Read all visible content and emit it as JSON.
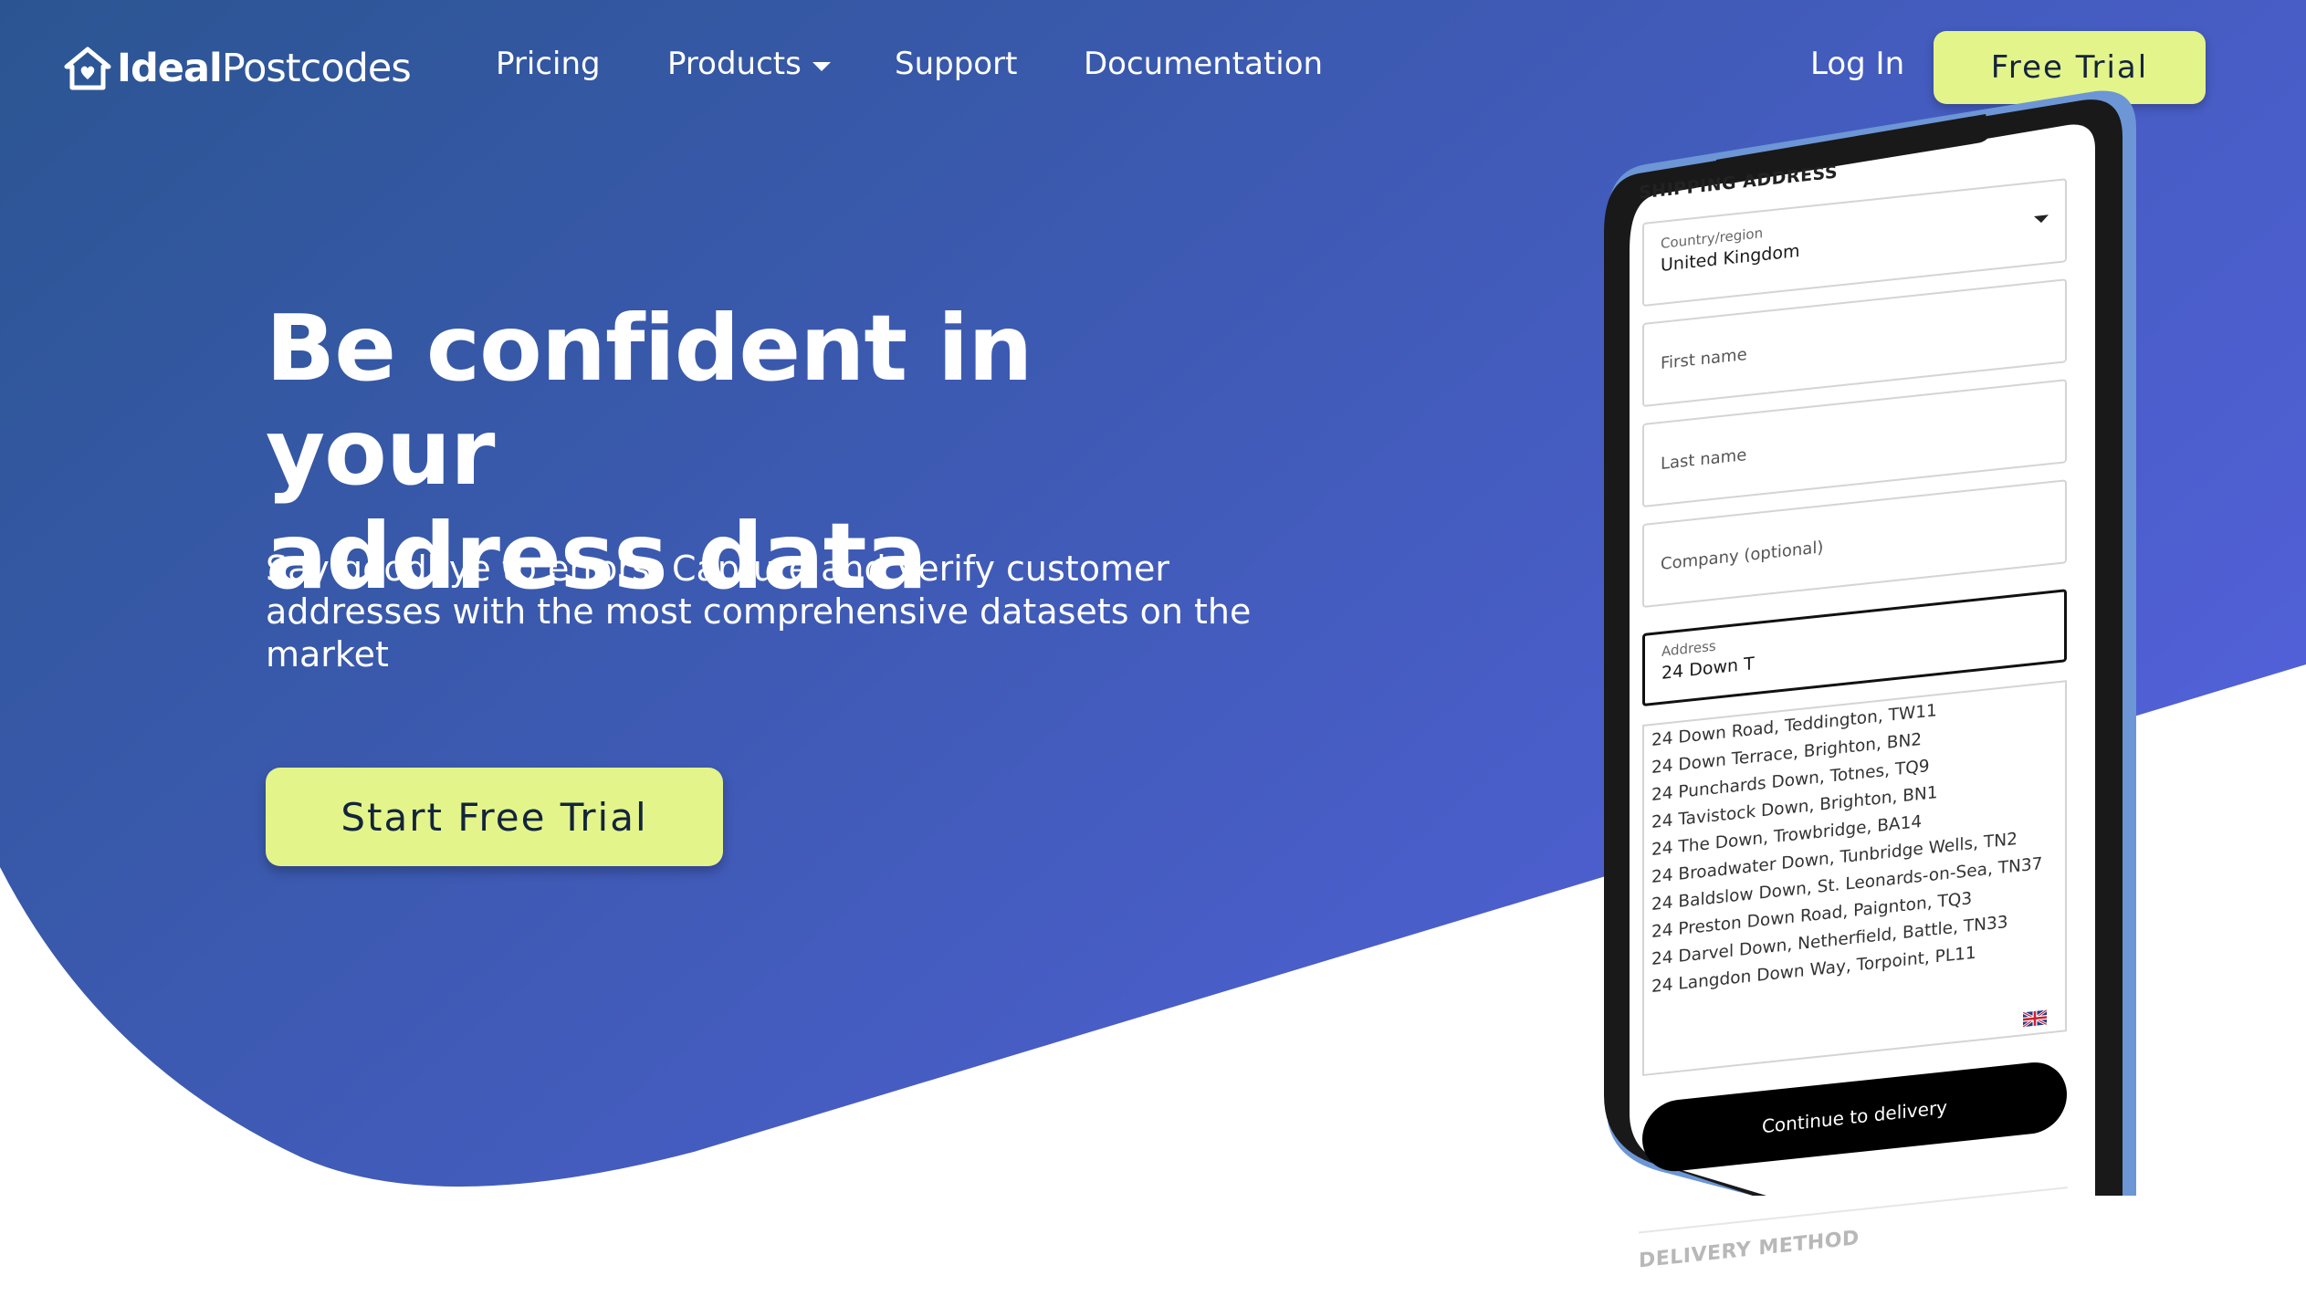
{
  "brand": {
    "name_bold": "Ideal",
    "name_light": "Postcodes",
    "bg_gradient_start": "#2b5592",
    "bg_gradient_end": "#5260d8",
    "accent": "#e3f48a"
  },
  "nav": {
    "items": [
      {
        "label": "Pricing"
      },
      {
        "label": "Products"
      },
      {
        "label": "Support"
      },
      {
        "label": "Documentation"
      }
    ],
    "login_label": "Log In",
    "trial_label": "Free Trial"
  },
  "hero": {
    "title_line1": "Be confident in your",
    "title_line2": "address data",
    "subtitle": "Say goodbye to errors. Capture and verify customer addresses with the most comprehensive datasets on the market",
    "cta_label": "Start Free Trial"
  },
  "phone_form": {
    "section_title": "SHIPPING ADDRESS",
    "country": {
      "label": "Country/region",
      "value": "United Kingdom"
    },
    "first_name": {
      "placeholder": "First name"
    },
    "last_name": {
      "placeholder": "Last name"
    },
    "company": {
      "placeholder": "Company (optional)"
    },
    "address": {
      "label": "Address",
      "value": "24 Down T"
    },
    "suggestions": [
      "24 Down Road, Teddington, TW11",
      "24 Down Terrace, Brighton, BN2",
      "24 Punchards Down, Totnes, TQ9",
      "24 Tavistock Down, Brighton, BN1",
      "24 The Down, Trowbridge, BA14",
      "24 Broadwater Down, Tunbridge Wells, TN2",
      "24 Baldslow Down, St. Leonards-on-Sea, TN37",
      "24 Preston Down Road, Paignton, TQ3",
      "24 Darvel Down, Netherfield, Battle, TN33",
      "24 Langdon Down Way, Torpoint, PL11"
    ],
    "flag_icon": "uk-flag-icon",
    "continue_label": "Continue to delivery",
    "next_section_title": "DELIVERY METHOD"
  }
}
